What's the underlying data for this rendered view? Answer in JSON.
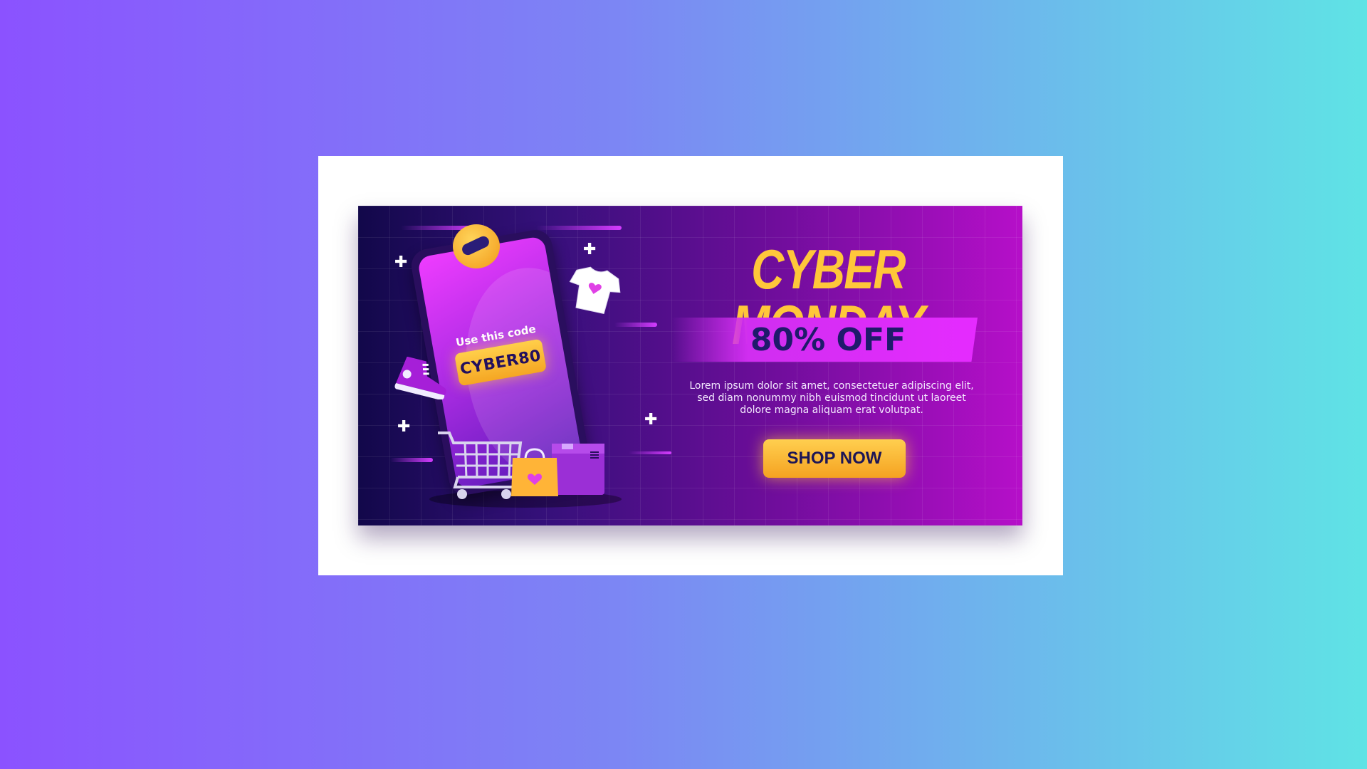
{
  "banner": {
    "title": "CYBER MONDAY",
    "offer": "80% OFF",
    "description": "Lorem ipsum dolor sit amet, consectetuer adipiscing elit, sed diam nonummy nibh euismod tincidunt ut laoreet dolore magna aliquam erat volutpat.",
    "cta_label": "SHOP NOW",
    "code_label": "Use this code",
    "code_value": "CYBER80"
  },
  "colors": {
    "background_left": "#8b52ff",
    "background_right": "#5fe3e5",
    "banner_dark": "#12084a",
    "banner_magenta": "#b60fc9",
    "accent_yellow": "#ffc73a",
    "text_navy": "#1f1a6b"
  },
  "icons": [
    "helmet-icon",
    "tshirt-icon",
    "sneaker-icon",
    "shopping-cart-icon",
    "shopping-bag-icon",
    "package-box-icon",
    "sparkle-icon"
  ]
}
